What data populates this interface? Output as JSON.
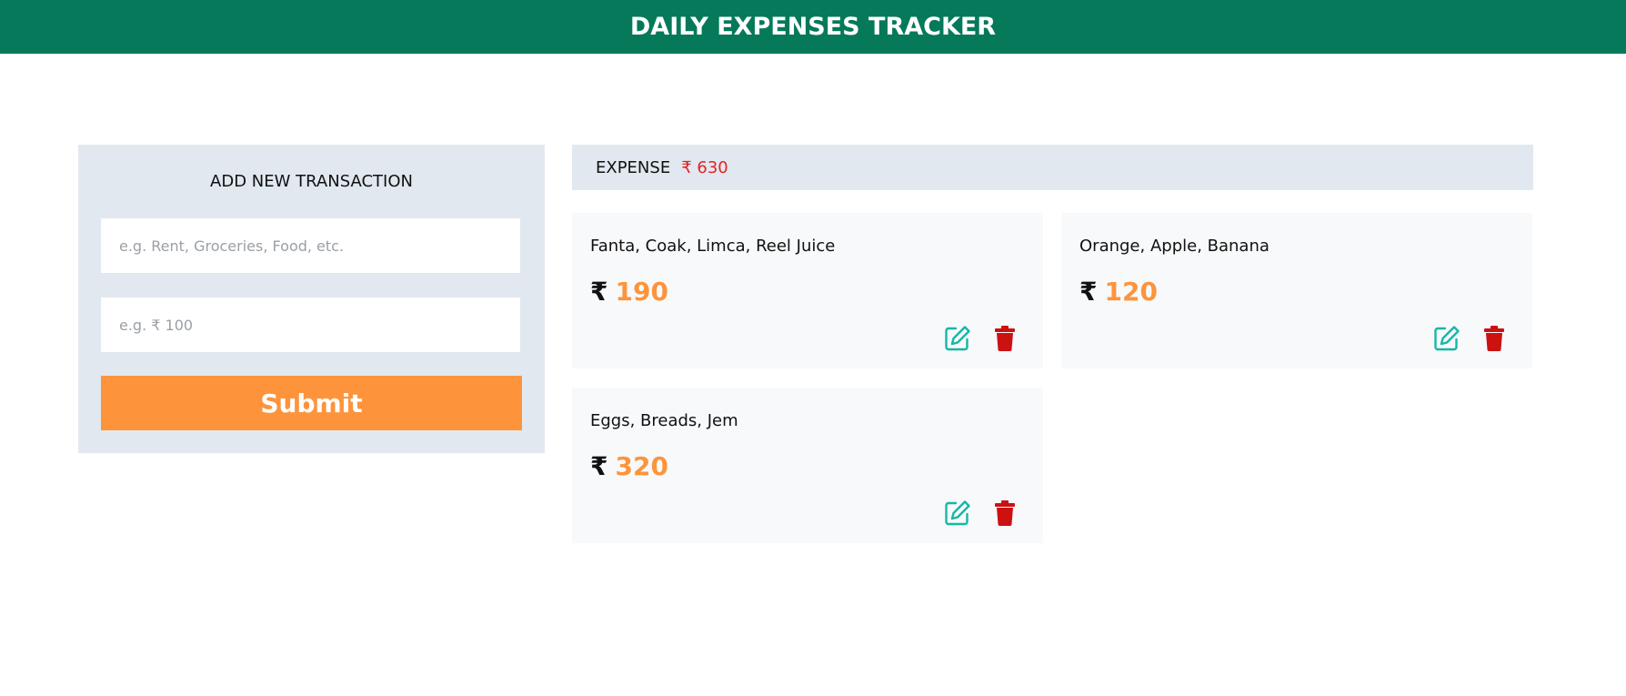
{
  "header": {
    "title": "DAILY EXPENSES TRACKER"
  },
  "form": {
    "title": "ADD NEW TRANSACTION",
    "description_placeholder": "e.g. Rent, Groceries, Food, etc.",
    "description_value": "",
    "amount_placeholder": "e.g. ₹ 100",
    "amount_value": "",
    "submit_label": "Submit"
  },
  "summary": {
    "label": "EXPENSE",
    "value": "₹ 630"
  },
  "expenses": [
    {
      "title": "Fanta, Coak, Limca, Reel Juice",
      "currency": "₹",
      "amount": "190"
    },
    {
      "title": "Orange, Apple, Banana",
      "currency": "₹",
      "amount": "120"
    },
    {
      "title": "Eggs, Breads, Jem",
      "currency": "₹",
      "amount": "320"
    }
  ],
  "icons": {
    "edit": "edit-icon",
    "delete": "trash-icon"
  },
  "colors": {
    "header_bg": "#05795a",
    "accent_orange": "#fd943c",
    "panel_bg": "#e2e8f0",
    "expense_red": "#e02424",
    "edit_green": "#14b8a6",
    "delete_red": "#cc1111"
  }
}
